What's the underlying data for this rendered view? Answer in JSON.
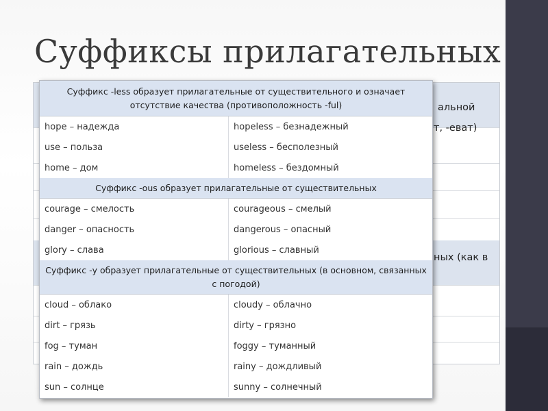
{
  "slide": {
    "title": "Суффиксы прилагательных"
  },
  "back_table": {
    "fragments": [
      "альной",
      "т, -еват)",
      "ных (как в"
    ]
  },
  "table": {
    "sections": [
      {
        "header": "Суффикс -less образует прилагательные от существительного и означает отсутствие качества (противоположность -ful)",
        "rows": [
          [
            "hope – надежда",
            "hopeless – безнадежный"
          ],
          [
            "use – польза",
            "useless – бесполезный"
          ],
          [
            "home – дом",
            "homeless – бездомный"
          ]
        ]
      },
      {
        "header": "Суффикс -ous образует прилагательные от существительных",
        "rows": [
          [
            "courage – смелость",
            "courageous – смелый"
          ],
          [
            "danger – опасность",
            "dangerous – опасный"
          ],
          [
            "glory – слава",
            "glorious – славный"
          ]
        ]
      },
      {
        "header": "Суффикс -y образует прилагательные от существительных (в основном, связанных с погодой)",
        "rows": [
          [
            "cloud – облако",
            "cloudy – облачно"
          ],
          [
            "dirt – грязь",
            "dirty – грязно"
          ],
          [
            "fog – туман",
            "foggy – туманный"
          ],
          [
            "rain – дождь",
            "rainy – дождливый"
          ],
          [
            "sun – солнце",
            "sunny – солнечный"
          ]
        ]
      }
    ]
  }
}
